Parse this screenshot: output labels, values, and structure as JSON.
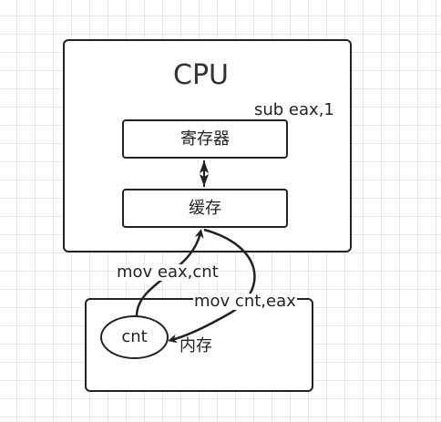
{
  "cpu": {
    "title": "CPU",
    "instruction": "sub eax,1",
    "register_label": "寄存器",
    "cache_label": "缓存"
  },
  "memory": {
    "label": "内存",
    "variable_label": "cnt"
  },
  "edges": {
    "load_label": "mov eax,cnt",
    "store_label": "mov cnt,eax"
  },
  "colors": {
    "stroke": "#222222",
    "grid": "#e6e6e6",
    "background": "#ffffff"
  }
}
